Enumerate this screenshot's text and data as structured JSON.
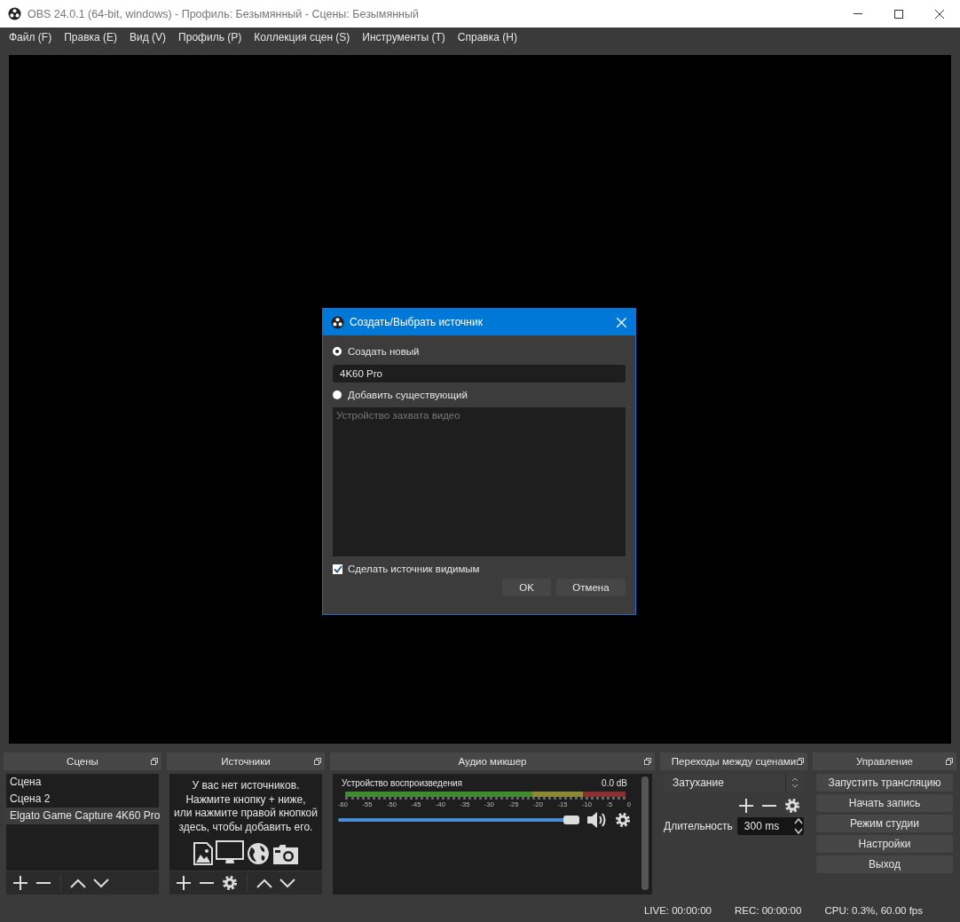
{
  "window": {
    "title": "OBS 24.0.1 (64-bit, windows) - Профиль: Безымянный - Сцены: Безымянный"
  },
  "menu": [
    "Файл (F)",
    "Правка (E)",
    "Вид (V)",
    "Профиль (P)",
    "Коллекция сцен (S)",
    "Инструменты (T)",
    "Справка (H)"
  ],
  "dialog": {
    "title": "Создать/Выбрать источник",
    "options": [
      {
        "label": "Создать новый",
        "selected": true
      },
      {
        "label": "Добавить существующий",
        "selected": false
      }
    ],
    "name_field": {
      "value": "4K60 Pro"
    },
    "existing_sources": [
      {
        "label": "Устройство захвата видео",
        "disabled": true
      }
    ],
    "visible_checkbox": {
      "label": "Сделать источник видимым",
      "checked": true
    },
    "buttons": [
      "OK",
      "Отмена"
    ]
  },
  "scenes": {
    "title": "Сцены",
    "items": [
      {
        "label": "Сцена",
        "selected": false
      },
      {
        "label": "Сцена 2",
        "selected": false
      },
      {
        "label": "Elgato Game Capture 4K60 Pro",
        "selected": true
      }
    ]
  },
  "sources": {
    "title": "Источники",
    "empty_message": [
      "У вас нет источников.",
      "Нажмите кнопку + ниже,",
      "или нажмите правой кнопкой",
      "здесь, чтобы добавить его."
    ]
  },
  "audio_mixer": {
    "title": "Аудио микшер",
    "channels": [
      {
        "name": "Устройство воспроизведения",
        "reading": "0.0 dB",
        "level": 0.97,
        "muted": false
      }
    ],
    "scale": [
      "-60",
      "-55",
      "-50",
      "-45",
      "-40",
      "-35",
      "-30",
      "-25",
      "-20",
      "-15",
      "-10",
      "-5",
      "0"
    ]
  },
  "transitions": {
    "title": "Переходы между сценами",
    "selected": "Затухание",
    "duration_label": "Длительность",
    "duration": "300 ms"
  },
  "controls": {
    "title": "Управление",
    "buttons": [
      "Запустить трансляцию",
      "Начать запись",
      "Режим студии",
      "Настройки",
      "Выход"
    ]
  },
  "status_bar": {
    "live": "LIVE: 00:00:00",
    "rec": "REC: 00:00:00",
    "cpu": "CPU: 0.3%, 60.00 fps"
  }
}
